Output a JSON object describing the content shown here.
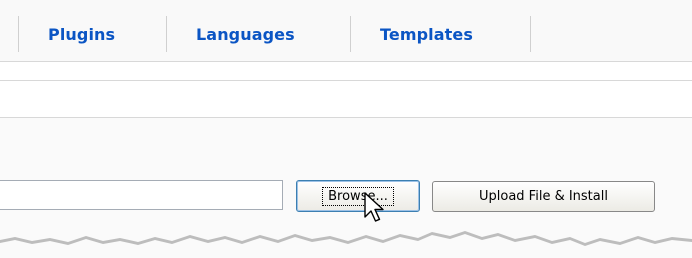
{
  "tabs": [
    {
      "label": "Plugins"
    },
    {
      "label": "Languages"
    },
    {
      "label": "Templates"
    }
  ],
  "upload": {
    "file_value": "",
    "browse_label": "Browse...",
    "upload_label": "Upload File & Install"
  },
  "colors": {
    "tab_text": "#0b55c4",
    "tabbar_bg": "#f9f9f9",
    "panel_bg": "#fafafa",
    "focus_border": "#3c7fb1"
  },
  "icons": {
    "pointer": "mouse-pointer-icon"
  }
}
